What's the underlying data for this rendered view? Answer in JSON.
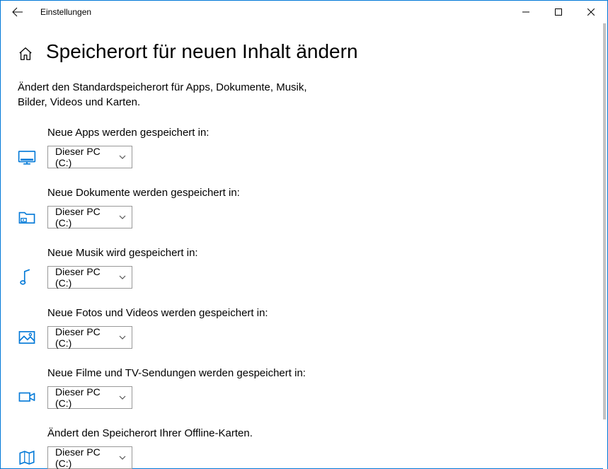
{
  "window": {
    "title": "Einstellungen"
  },
  "page": {
    "heading": "Speicherort für neuen Inhalt ändern",
    "description": "Ändert den Standardspeicherort für Apps, Dokumente, Musik, Bilder, Videos und Karten."
  },
  "common": {
    "default_drive": "Dieser PC (C:)"
  },
  "settings": [
    {
      "label": "Neue Apps werden gespeichert in:",
      "value": "Dieser PC (C:)"
    },
    {
      "label": "Neue Dokumente werden gespeichert in:",
      "value": "Dieser PC (C:)"
    },
    {
      "label": "Neue Musik wird gespeichert in:",
      "value": "Dieser PC (C:)"
    },
    {
      "label": "Neue Fotos und Videos werden gespeichert in:",
      "value": "Dieser PC (C:)"
    },
    {
      "label": "Neue Filme und TV-Sendungen werden gespeichert in:",
      "value": "Dieser PC (C:)"
    },
    {
      "label": "Ändert den Speicherort Ihrer Offline-Karten.",
      "value": "Dieser PC (C:)"
    }
  ]
}
